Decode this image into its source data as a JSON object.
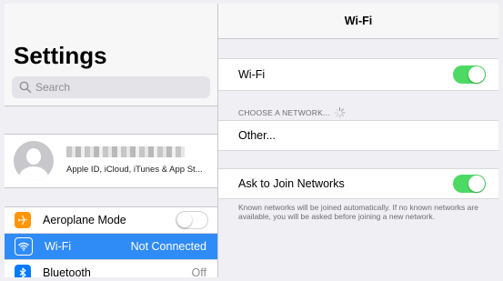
{
  "sidebar": {
    "title": "Settings",
    "search_placeholder": "Search",
    "profile": {
      "subtitle": "Apple ID, iCloud, iTunes & App St..."
    },
    "items": [
      {
        "label": "Aeroplane Mode",
        "icon": "airplane-icon",
        "color": "#ff9500",
        "toggle": false
      },
      {
        "label": "Wi-Fi",
        "value": "Not Connected",
        "icon": "wifi-icon",
        "color": "#2f8bf5",
        "selected": true
      },
      {
        "label": "Bluetooth",
        "value": "Off",
        "icon": "bluetooth-icon",
        "color": "#007aff"
      }
    ]
  },
  "detail": {
    "title": "Wi-Fi",
    "wifi_label": "Wi-Fi",
    "wifi_on": true,
    "choose_network_header": "CHOOSE A NETWORK...",
    "other_label": "Other...",
    "ask_join_label": "Ask to Join Networks",
    "ask_join_on": true,
    "ask_join_footnote": "Known networks will be joined automatically. If no known networks are available, you will be asked before joining a new network."
  },
  "colors": {
    "accent": "#2f8bf5",
    "toggle_on": "#4cd964"
  }
}
